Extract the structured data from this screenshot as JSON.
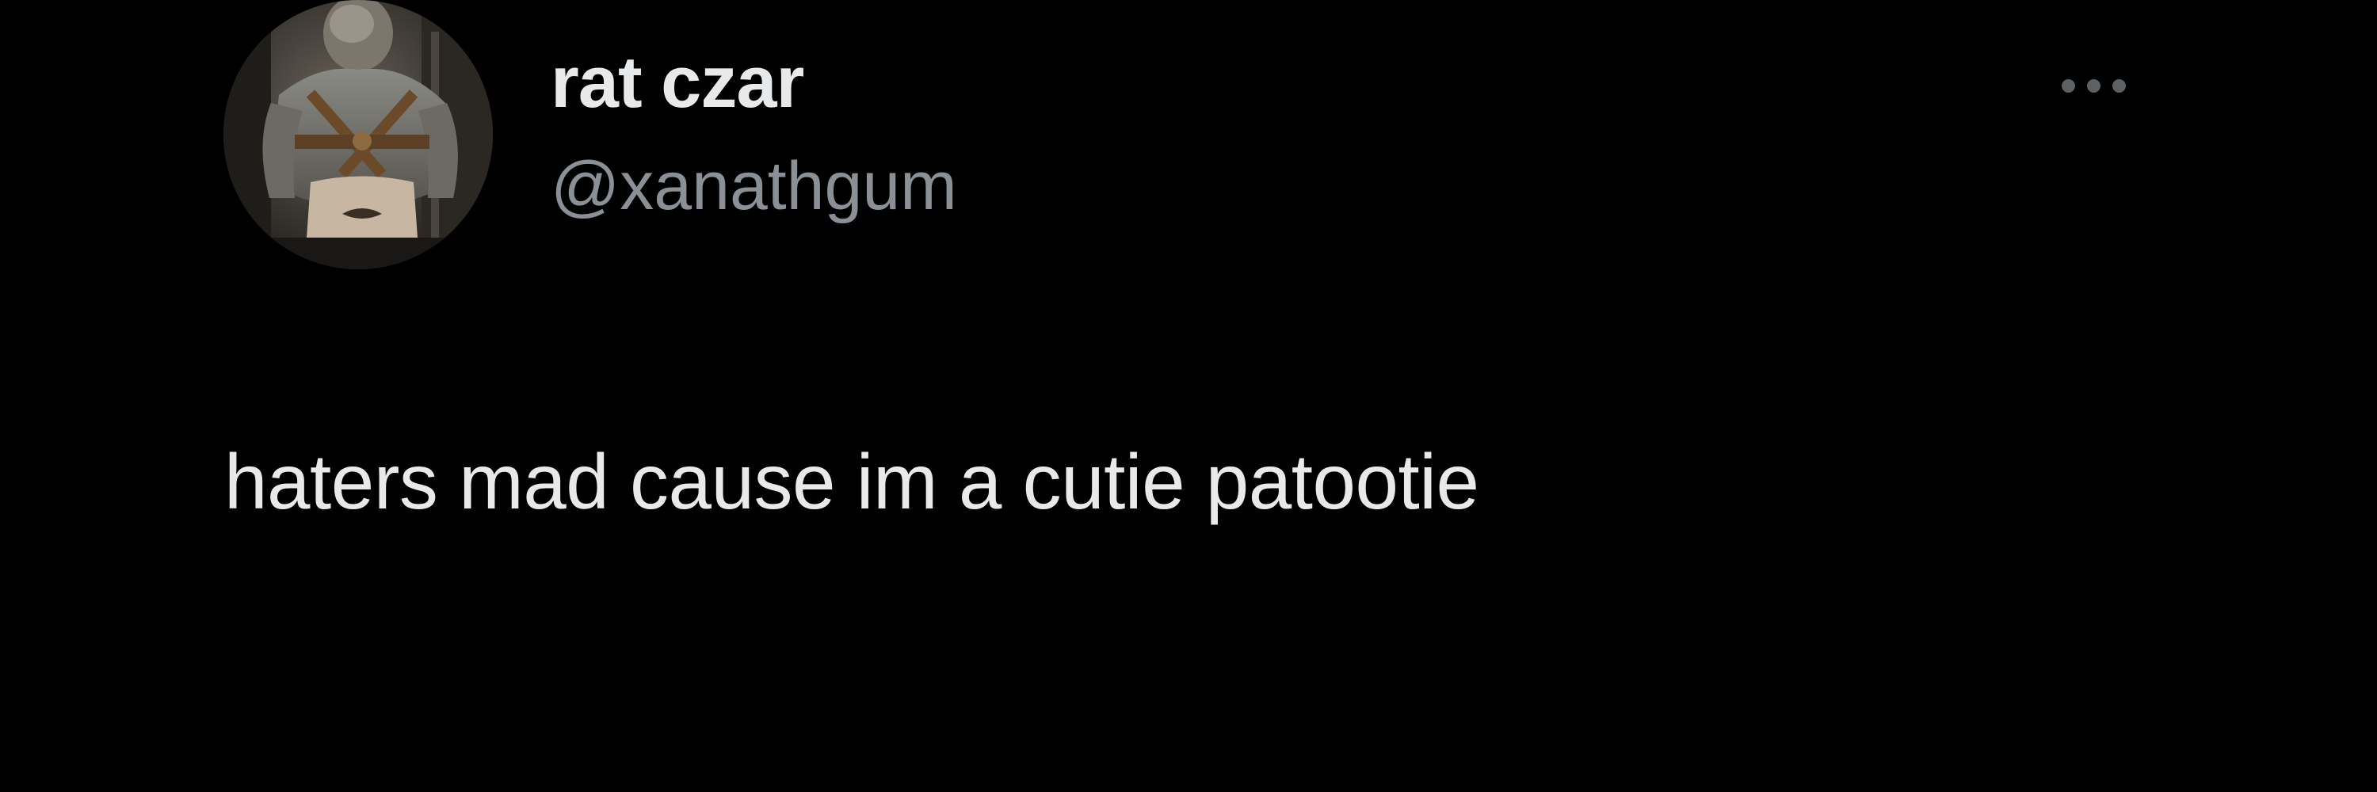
{
  "tweet": {
    "author": {
      "display_name": "rat czar",
      "handle": "@xanathgum",
      "avatar": "profile-photo"
    },
    "text": "haters mad cause im a cutie patootie",
    "menu_icon": "more-horizontal-icon"
  },
  "colors": {
    "background": "#000000",
    "primary_text": "#e7e9ea",
    "secondary_text": "#8b9096",
    "icon": "#5d6166"
  }
}
